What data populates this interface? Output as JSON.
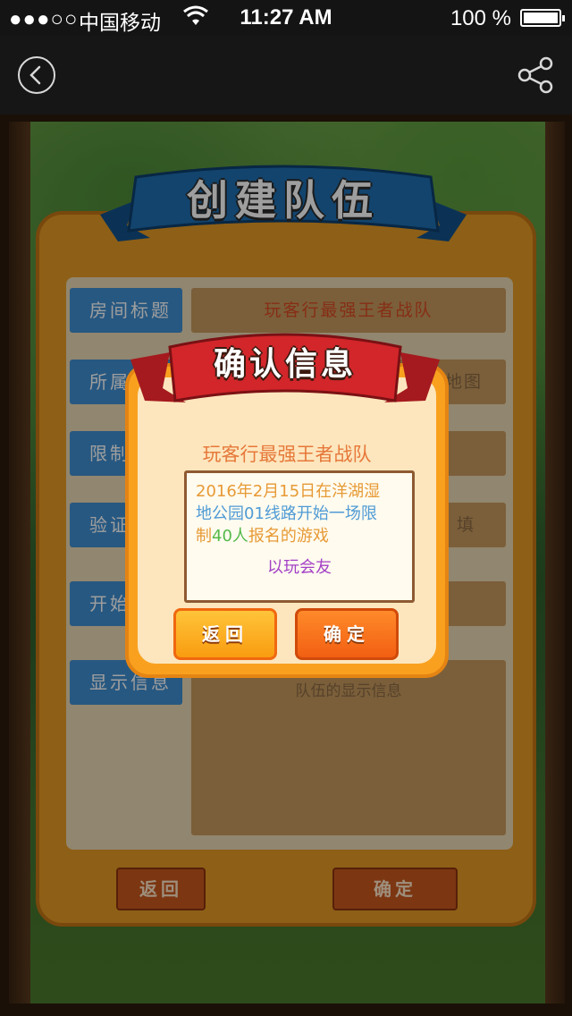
{
  "status_bar": {
    "signal": "●●●○○",
    "carrier": "中国移动",
    "time": "11:27 AM",
    "battery": "100 %"
  },
  "nav": {
    "back_icon": "chevron-left-icon",
    "share_icon": "share-icon"
  },
  "panel": {
    "title": "创建队伍",
    "rows": [
      {
        "label": "房间标题",
        "value": "玩客行最强王者战队"
      },
      {
        "label": "所属",
        "value": "地图"
      },
      {
        "label": "限制",
        "value": ""
      },
      {
        "label": "验证",
        "value": "填"
      },
      {
        "label": "开始",
        "value": ""
      },
      {
        "label": "显示信息",
        "value": "队伍的显示信息"
      }
    ],
    "back_button": "返回",
    "confirm_button": "确定"
  },
  "modal": {
    "title": "确认信息",
    "team_name": "玩客行最强王者战队",
    "line1": "2016年2月15日在洋湖湿",
    "line2": "地公园01线路开始一场限",
    "line3_a": "制",
    "line3_b": "40人",
    "line3_c": "报名的游戏",
    "line4": "以玩会友",
    "back_button": "返回",
    "confirm_button": "确定"
  },
  "colors": {
    "ribbon_blue": "#1d6fb0",
    "ribbon_red": "#d2262a",
    "label_blue": "#3f8fd0",
    "panel_orange": "#e59a24"
  }
}
